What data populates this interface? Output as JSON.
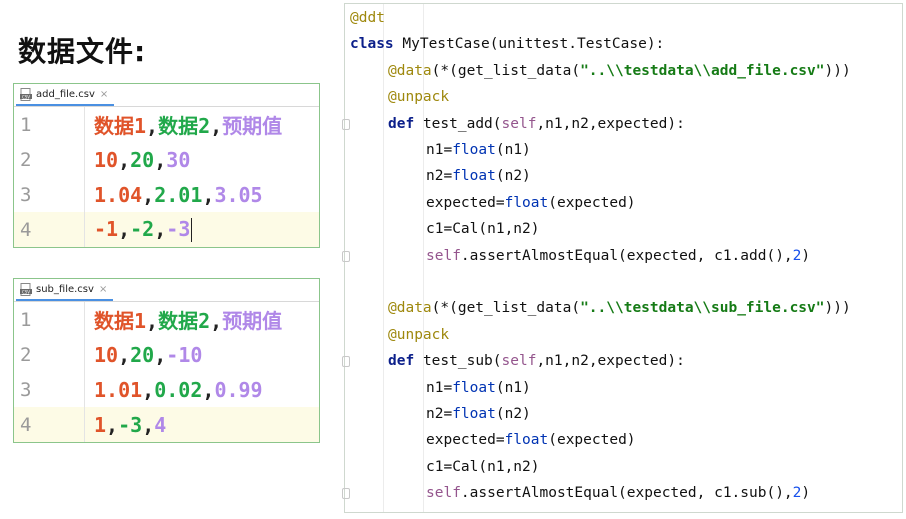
{
  "heading": "数据文件:",
  "files": [
    {
      "tab": "add_file.csv",
      "tab_close": "×",
      "current_line": 4,
      "rows": [
        {
          "n": "1",
          "cells": [
            "数据1",
            "数据2",
            "预期值"
          ]
        },
        {
          "n": "2",
          "cells": [
            "10",
            "20",
            "30"
          ]
        },
        {
          "n": "3",
          "cells": [
            "1.04",
            "2.01",
            "3.05"
          ]
        },
        {
          "n": "4",
          "cells": [
            "-1",
            "-2",
            "-3"
          ]
        }
      ]
    },
    {
      "tab": "sub_file.csv",
      "tab_close": "×",
      "current_line": 4,
      "rows": [
        {
          "n": "1",
          "cells": [
            "数据1",
            "数据2",
            "预期值"
          ]
        },
        {
          "n": "2",
          "cells": [
            "10",
            "20",
            "-10"
          ]
        },
        {
          "n": "3",
          "cells": [
            "1.01",
            "0.02",
            "0.99"
          ]
        },
        {
          "n": "4",
          "cells": [
            "1",
            "-3",
            "4"
          ]
        }
      ]
    }
  ],
  "colors": {
    "col0": "#e0542a",
    "col1": "#21a84a",
    "col2": "#b088e8",
    "separator": "#222222",
    "tab_underline": "#4a90e2",
    "border": "#8bc58b"
  },
  "code_lines": [
    {
      "indent": 0,
      "tokens": [
        [
          "deco",
          "@ddt"
        ]
      ]
    },
    {
      "indent": 0,
      "tokens": [
        [
          "kw",
          "class"
        ],
        [
          "",
          "MyTestCase(unittest.TestCase):"
        ]
      ]
    },
    {
      "indent": 1,
      "tokens": [
        [
          "deco",
          "@data"
        ],
        [
          "",
          "(*(get_list_data("
        ],
        [
          "str",
          "\"..\\\\testdata\\\\add_file.csv\""
        ],
        [
          "",
          "))) "
        ]
      ]
    },
    {
      "indent": 1,
      "tokens": [
        [
          "deco",
          "@unpack"
        ]
      ]
    },
    {
      "indent": 1,
      "tokens": [
        [
          "kw",
          "def"
        ],
        [
          "",
          "test_add("
        ],
        [
          "self",
          "self"
        ],
        [
          "",
          ",n1,n2,expected):"
        ]
      ]
    },
    {
      "indent": 2,
      "tokens": [
        [
          "",
          "n1="
        ],
        [
          "blt",
          "float"
        ],
        [
          "",
          "(n1)"
        ]
      ]
    },
    {
      "indent": 2,
      "tokens": [
        [
          "",
          "n2="
        ],
        [
          "blt",
          "float"
        ],
        [
          "",
          "(n2)"
        ]
      ]
    },
    {
      "indent": 2,
      "tokens": [
        [
          "",
          "expected="
        ],
        [
          "blt",
          "float"
        ],
        [
          "",
          "(expected)"
        ]
      ]
    },
    {
      "indent": 2,
      "tokens": [
        [
          "",
          "c1=Cal(n1,n2)"
        ]
      ]
    },
    {
      "indent": 2,
      "tokens": [
        [
          "self",
          "self"
        ],
        [
          "",
          ".assertAlmostEqual(expected, c1.add(),"
        ],
        [
          "num",
          "2"
        ],
        [
          "",
          ")"
        ]
      ]
    },
    {
      "indent": 0,
      "tokens": []
    },
    {
      "indent": 1,
      "tokens": [
        [
          "deco",
          "@data"
        ],
        [
          "",
          "(*(get_list_data("
        ],
        [
          "str",
          "\"..\\\\testdata\\\\sub_file.csv\""
        ],
        [
          "",
          ")))"
        ]
      ]
    },
    {
      "indent": 1,
      "tokens": [
        [
          "deco",
          "@unpack"
        ]
      ]
    },
    {
      "indent": 1,
      "tokens": [
        [
          "kw",
          "def"
        ],
        [
          "",
          "test_sub("
        ],
        [
          "self",
          "self"
        ],
        [
          "",
          ",n1,n2,expected):"
        ]
      ]
    },
    {
      "indent": 2,
      "tokens": [
        [
          "",
          "n1="
        ],
        [
          "blt",
          "float"
        ],
        [
          "",
          "(n1)"
        ]
      ]
    },
    {
      "indent": 2,
      "tokens": [
        [
          "",
          "n2="
        ],
        [
          "blt",
          "float"
        ],
        [
          "",
          "(n2)"
        ]
      ]
    },
    {
      "indent": 2,
      "tokens": [
        [
          "",
          "expected="
        ],
        [
          "blt",
          "float"
        ],
        [
          "",
          "(expected)"
        ]
      ]
    },
    {
      "indent": 2,
      "tokens": [
        [
          "",
          "c1=Cal(n1,n2)"
        ]
      ]
    },
    {
      "indent": 2,
      "tokens": [
        [
          "self",
          "self"
        ],
        [
          "",
          ".assertAlmostEqual(expected, c1.sub(),"
        ],
        [
          "num",
          "2"
        ],
        [
          "",
          ")"
        ]
      ]
    }
  ]
}
